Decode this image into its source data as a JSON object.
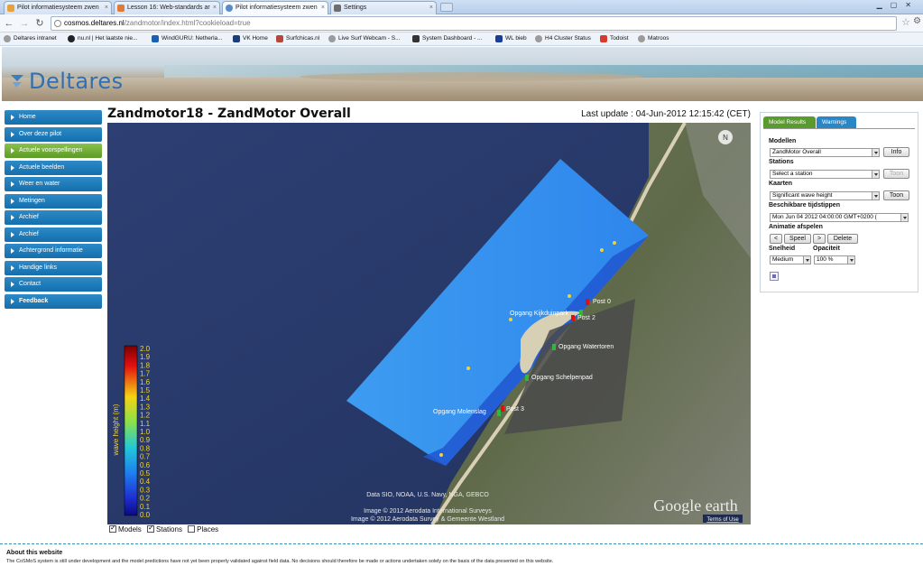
{
  "browser": {
    "tabs": [
      {
        "label": "Pilot informatiesysteem zwen",
        "color": "#e7a13a"
      },
      {
        "label": "Lesson 16: Web-standards ar",
        "color": "#e07a3a"
      },
      {
        "label": "Pilot informatiesysteem zwen",
        "color": "#5a8ac8"
      },
      {
        "label": "Settings",
        "color": "#6d6d6d"
      }
    ],
    "url_host": "cosmos.deltares.nl",
    "url_path": "/zandmotor/index.html?cookieload=true",
    "bookmarks": [
      {
        "label": "Deltares intranet",
        "color": "#9b9b9b"
      },
      {
        "label": "nu.nl | Het laatste nie...",
        "color": "#222222"
      },
      {
        "label": "WindGURU: Netherla...",
        "color": "#1a5fb4"
      },
      {
        "label": "VK Home",
        "color": "#1b3d7a"
      },
      {
        "label": "Surfchicas.nl",
        "color": "#b5483a"
      },
      {
        "label": "Live Surf Webcam - S...",
        "color": "#9b9b9b"
      },
      {
        "label": "System Dashboard - ...",
        "color": "#333333"
      },
      {
        "label": "WL bieb",
        "color": "#1b3d9a"
      },
      {
        "label": "H4 Cluster Status",
        "color": "#9b9b9b"
      },
      {
        "label": "Todoist",
        "color": "#d73a2a"
      },
      {
        "label": "Matroos",
        "color": "#9b9b9b"
      }
    ]
  },
  "brand": {
    "logo_text": "Deltares",
    "color": "#2f6fb5"
  },
  "nav": {
    "items": [
      {
        "label": "Home",
        "active": false,
        "bold": false
      },
      {
        "label": "Over deze pilot",
        "active": false,
        "bold": false
      },
      {
        "label": "Actuele voorspellingen",
        "active": true,
        "bold": false
      },
      {
        "label": "Actuele beelden",
        "active": false,
        "bold": false
      },
      {
        "label": "Weer en water",
        "active": false,
        "bold": false
      },
      {
        "label": "Metingen",
        "active": false,
        "bold": false
      },
      {
        "label": "Archief",
        "active": false,
        "bold": false
      },
      {
        "label": "Archief",
        "active": false,
        "bold": false
      },
      {
        "label": "Achtergrond informatie",
        "active": false,
        "bold": false
      },
      {
        "label": "Handige links",
        "active": false,
        "bold": false
      },
      {
        "label": "Contact",
        "active": false,
        "bold": false
      },
      {
        "label": "Feedback",
        "active": false,
        "bold": true
      }
    ]
  },
  "page": {
    "title": "Zandmotor18 - ZandMotor Overall",
    "last_update": "Last update : 04-Jun-2012 12:15:42 (CET)"
  },
  "map": {
    "colorbar_label": "wave height (m)",
    "colorbar_ticks": [
      "2.0",
      "1.9",
      "1.8",
      "1.7",
      "1.6",
      "1.5",
      "1.4",
      "1.3",
      "1.2",
      "1.1",
      "1.0",
      "0.9",
      "0.8",
      "0.7",
      "0.6",
      "0.5",
      "0.4",
      "0.3",
      "0.2",
      "0.1",
      "0.0"
    ],
    "stations": [
      {
        "label": "Post 0"
      },
      {
        "label": "Opgang Kijkduinpark"
      },
      {
        "label": "Post 2"
      },
      {
        "label": "Opgang Watertoren"
      },
      {
        "label": "Opgang Schelpenpad"
      },
      {
        "label": "Opgang Molenslag"
      },
      {
        "label": "Post 3"
      }
    ],
    "attribution": [
      "Data SIO, NOAA, U.S. Navy, NGA, GEBCO",
      "Image © 2012 Aerodata International Surveys",
      "Image © 2012 Aerodata Survey & Gemeente Westland"
    ],
    "watermark": "Google earth",
    "terms": "Terms of Use",
    "compass": "N"
  },
  "layers": [
    {
      "label": "Models",
      "checked": true
    },
    {
      "label": "Stations",
      "checked": true
    },
    {
      "label": "Places",
      "checked": false
    }
  ],
  "panel": {
    "tab_results": "Model Results",
    "tab_warnings": "Warnings",
    "modellen_label": "Modellen",
    "modellen_value": "ZandMotor Overall",
    "info_button": "Info",
    "stations_label": "Stations",
    "stations_value": "Select a station",
    "toon_button": "Toon",
    "kaarten_label": "Kaarten",
    "kaarten_value": "Significant wave height",
    "toon_button2": "Toon",
    "tijdstippen_label": "Beschikbare tijdstippen",
    "tijdstippen_value": "Mon Jun 04 2012 04:00:00 GMT+0200 (",
    "animatie_label": "Animatie afspelen",
    "prev_button": "<",
    "play_button": "Speel",
    "next_button": ">",
    "delete_button": "Delete",
    "snelheid_label": "Snelheid",
    "snelheid_value": "Medium",
    "opaciteit_label": "Opaciteit",
    "opaciteit_value": "100 %"
  },
  "footer": {
    "title": "About this website",
    "text": "The CoSMoS system is still under development and the model predictions have not yet been properly validated against field data. No decisions should therefore be made or actions undertaken solely on the basis of the data presented on this website."
  }
}
